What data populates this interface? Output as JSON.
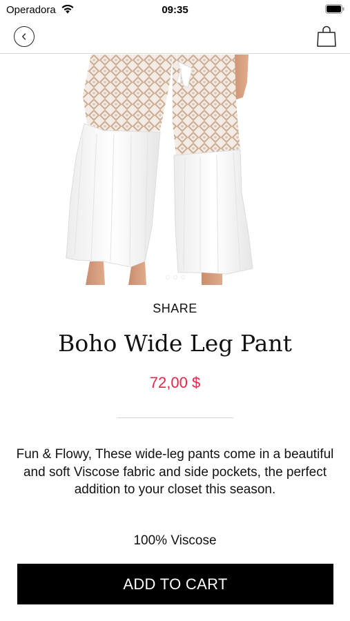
{
  "status_bar": {
    "carrier": "Operadora",
    "time": "09:35"
  },
  "nav": {
    "back_icon": "chevron-left-circle-icon",
    "cart_icon": "shopping-bag-icon"
  },
  "product": {
    "image_description_icon": "product-photo",
    "carousel_dots": 3,
    "share_label": "SHARE",
    "title": "Boho Wide Leg Pant",
    "price": "72,00 $",
    "description": "Fun & Flowy, These wide-leg pants come in a beautiful and soft Viscose fabric and side pockets, the perfect addition to your closet this season.",
    "material": "100% Viscose"
  },
  "actions": {
    "add_to_cart_label": "ADD TO CART"
  },
  "colors": {
    "price": "#e4284a",
    "button_bg": "#000000",
    "button_text": "#ffffff"
  }
}
